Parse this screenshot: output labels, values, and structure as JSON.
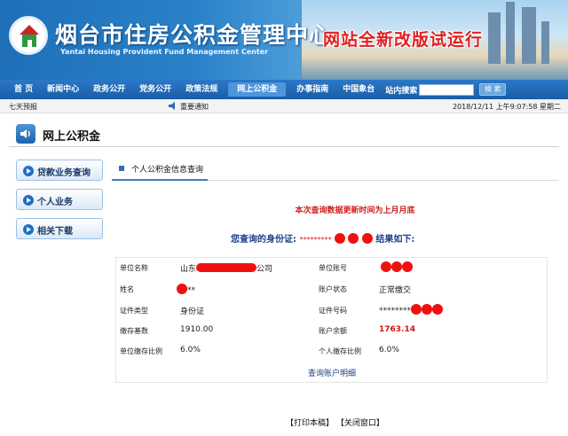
{
  "header": {
    "title": "烟台市住房公积金管理中心",
    "subtitle": "Yantai Housing Provident Fund Management Center",
    "trial_notice": "网站全新改版试运行"
  },
  "nav": {
    "items": [
      "首 页",
      "新闻中心",
      "政务公开",
      "党务公开",
      "政策法规",
      "网上公积金",
      "办事指南",
      "中国象台",
      "站内搜索"
    ],
    "active": "网上公积金",
    "search_button": "検 索"
  },
  "infobar": {
    "weather": "七天预报",
    "notice": "重要通知",
    "datetime": "2018/12/11 上午9:07:58 星期二"
  },
  "section": {
    "title": "网上公积金"
  },
  "sidebar": {
    "items": [
      "贷款业务查询",
      "个人业务",
      "相关下载"
    ]
  },
  "tab": {
    "label": "个人公积金信息查询"
  },
  "update_note": "本次查询数据更新时间为上月月底",
  "query": {
    "prefix": "您查询的身份证:",
    "masked": "*********",
    "suffix": "结果如下:"
  },
  "table": {
    "labels": {
      "unit_name": "单位名称",
      "unit_account": "单位账号",
      "name": "姓名",
      "account_status": "账户状态",
      "id_type": "证件类型",
      "id_number": "证件号码",
      "deposit_base": "缴存基数",
      "account_balance": "账户余额",
      "unit_ratio": "单位缴存比例",
      "personal_ratio": "个人缴存比例"
    },
    "values": {
      "unit_name_prefix": "山东",
      "unit_name_suffix": "公司",
      "name_suffix": "**",
      "account_status": "正常缴交",
      "id_type": "身份证",
      "id_number_masked": "********",
      "deposit_base": "1910.00",
      "account_balance": "1763.14",
      "unit_ratio": "6.0%",
      "personal_ratio": "6.0%"
    },
    "detail_link": "查询账户明细"
  },
  "actions": {
    "print": "【打印本稿】",
    "close": "【关闭窗口】"
  }
}
